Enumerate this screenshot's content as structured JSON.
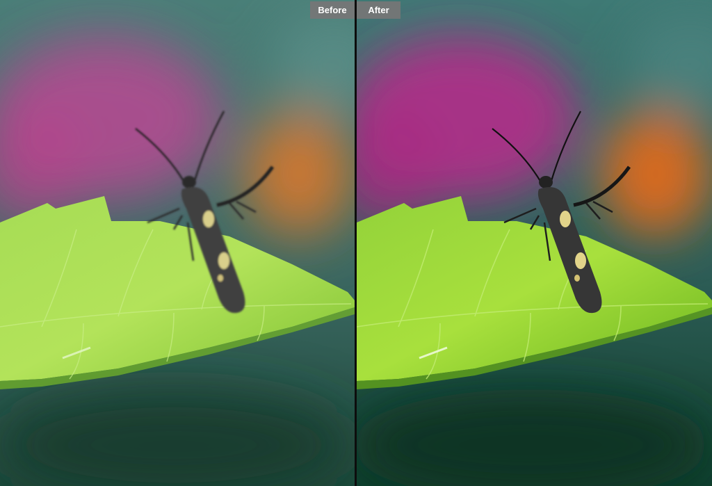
{
  "compare": {
    "before_label": "Before",
    "after_label": "After"
  },
  "colors": {
    "label_bg": "#767676",
    "label_text": "#ffffff",
    "divider": "#0d0d0d",
    "leaf": "#9ad63a",
    "background_teal": "#3d6e67",
    "background_magenta": "#b23c8a",
    "background_orange": "#d9722a",
    "moth": "#3a3a3a"
  },
  "scene": {
    "subject": "moth-icon",
    "perch": "leaf-icon"
  }
}
